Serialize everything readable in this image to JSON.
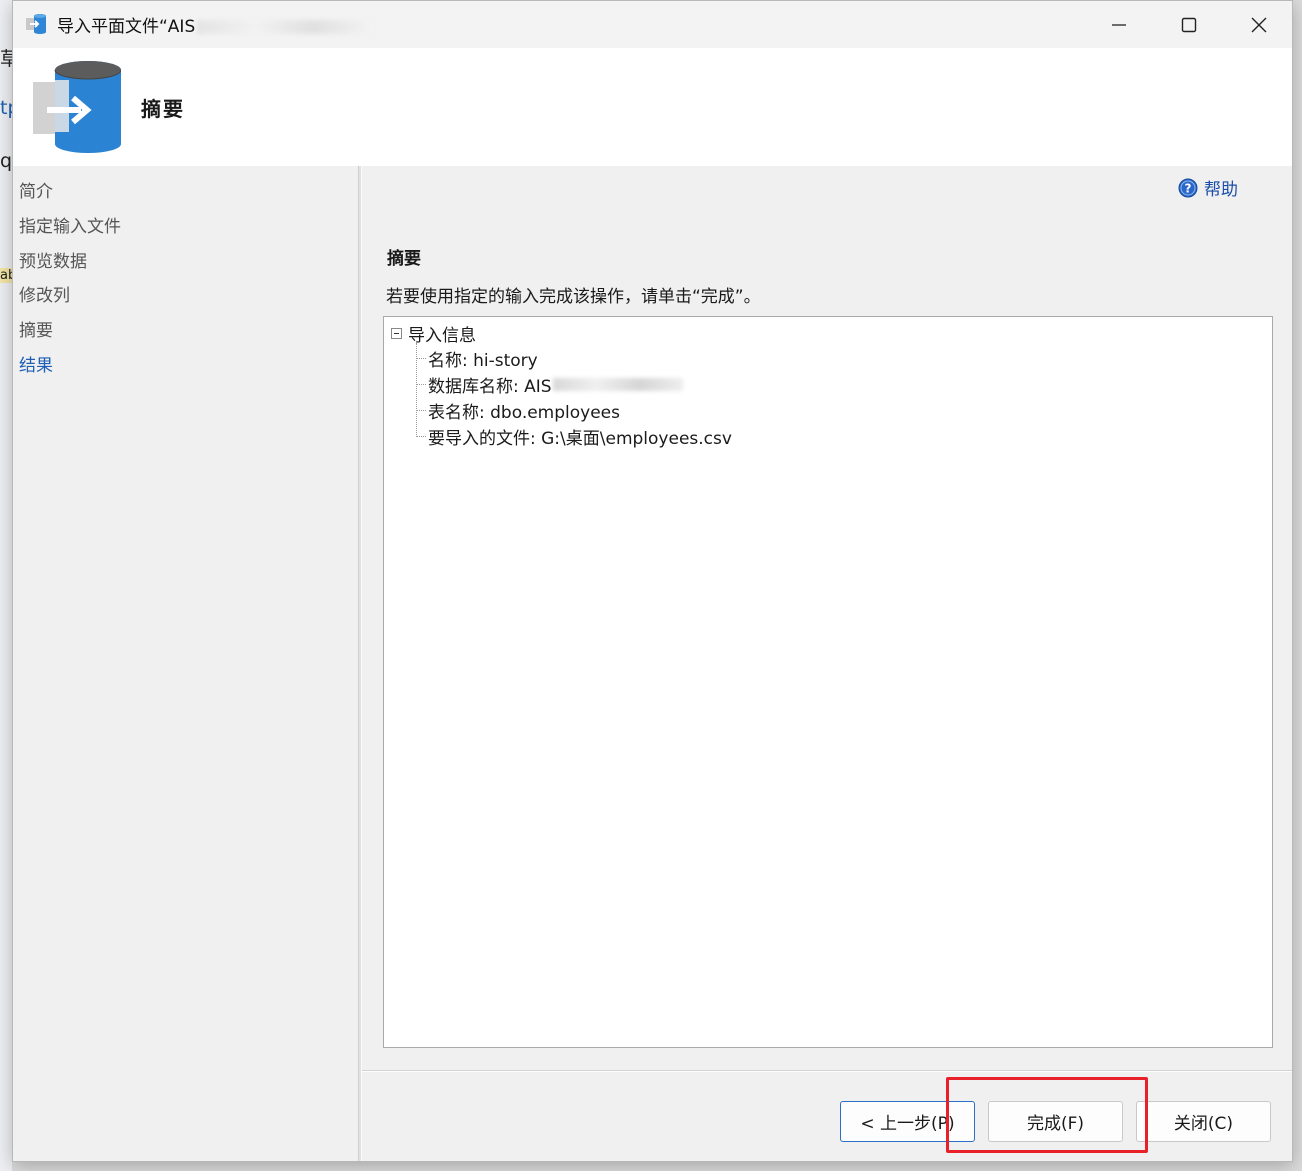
{
  "window": {
    "title": "导入平面文件“AIS",
    "controls": {
      "minimize": "minimize-icon",
      "maximize": "maximize-icon",
      "close": "close-icon"
    }
  },
  "header": {
    "title": "摘要"
  },
  "nav": {
    "items": [
      {
        "label": "简介"
      },
      {
        "label": "指定输入文件"
      },
      {
        "label": "预览数据"
      },
      {
        "label": "修改列"
      },
      {
        "label": "摘要"
      },
      {
        "label": "结果"
      }
    ],
    "active_index": 5
  },
  "help": {
    "label": "帮助"
  },
  "summary": {
    "title": "摘要",
    "instruction": "若要使用指定的输入完成该操作，请单击“完成”。",
    "tree": {
      "root": "导入信息",
      "children": [
        {
          "text": "名称: hi-story"
        },
        {
          "text": "数据库名称: AIS"
        },
        {
          "text": "表名称: dbo.employees"
        },
        {
          "text": "要导入的文件: G:\\桌面\\employees.csv"
        }
      ]
    }
  },
  "buttons": {
    "prev": "< 上一步(P)",
    "finish": "完成(F)",
    "close": "关闭(C)"
  },
  "bg_fragments": [
    "草",
    "tp",
    "q",
    "ab"
  ],
  "colors": {
    "accent": "#1e5fb4",
    "highlight": "#e8202a",
    "default_border": "#2b6fc9"
  }
}
